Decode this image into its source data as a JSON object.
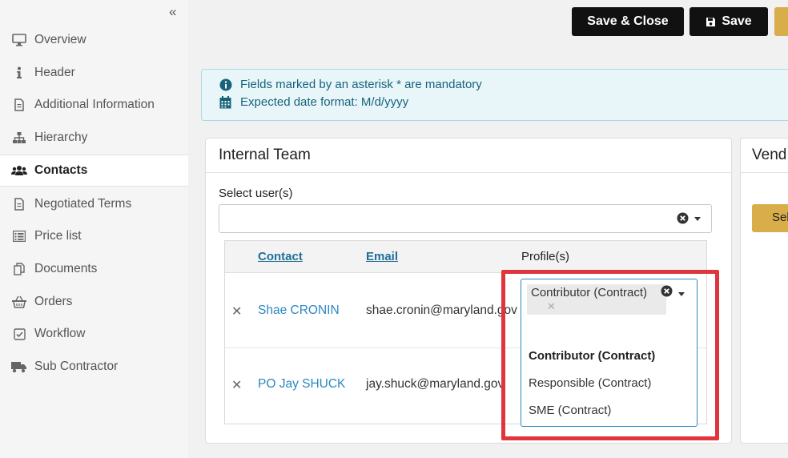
{
  "sidebar": {
    "collapse_label": "«",
    "items": [
      {
        "label": "Overview",
        "icon": "monitor-icon"
      },
      {
        "label": "Header",
        "icon": "info-icon"
      },
      {
        "label": "Additional Information",
        "icon": "document-icon"
      },
      {
        "label": "Hierarchy",
        "icon": "sitemap-icon"
      },
      {
        "label": "Contacts",
        "icon": "users-icon",
        "active": true
      },
      {
        "label": "Negotiated Terms",
        "icon": "document-icon"
      },
      {
        "label": "Price list",
        "icon": "list-icon"
      },
      {
        "label": "Documents",
        "icon": "copy-icon"
      },
      {
        "label": "Orders",
        "icon": "basket-icon"
      },
      {
        "label": "Workflow",
        "icon": "checkbox-icon"
      },
      {
        "label": "Sub Contractor",
        "icon": "truck-icon"
      }
    ]
  },
  "toolbar": {
    "save_close_label": "Save & Close",
    "save_label": "Save"
  },
  "info": {
    "mandatory_text": "Fields marked by an asterisk * are mandatory",
    "date_format_text": "Expected date format: M/d/yyyy"
  },
  "internal_team": {
    "title": "Internal Team",
    "select_label": "Select user(s)",
    "columns": {
      "contact": "Contact",
      "email": "Email",
      "profiles": "Profile(s)"
    },
    "rows": [
      {
        "name": "Shae CRONIN",
        "email": "shae.cronin@maryland.gov"
      },
      {
        "name": "PO Jay SHUCK",
        "email": "jay.shuck@maryland.gov"
      }
    ]
  },
  "vendor_panel": {
    "title": "Vend",
    "button_label": "Sel"
  },
  "profile_dropdown": {
    "selected_tag": "Contributor (Contract)",
    "options": [
      "Contributor (Contract)",
      "Responsible (Contract)",
      "SME (Contract)"
    ]
  },
  "colors": {
    "accent_blue": "#2a88c2",
    "gold": "#d8ad4a",
    "highlight_red": "#e0353c",
    "info_bg": "#e8f6fa"
  }
}
